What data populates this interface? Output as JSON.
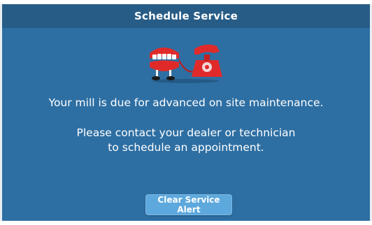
{
  "dialog": {
    "title": "Schedule Service",
    "illustration_icon": "chattering-teeth-and-telephone-icon",
    "message_line1": "Your mill is due for advanced on site maintenance.",
    "message_line2a": "Please contact your dealer or technician",
    "message_line2b": "to schedule an appointment.",
    "clear_button_label": "Clear Service Alert"
  },
  "colors": {
    "dialog_background": "#2e6fa3",
    "title_bar": "#275c86",
    "button": "#5da8dd",
    "illustration_red": "#e02a2a"
  }
}
